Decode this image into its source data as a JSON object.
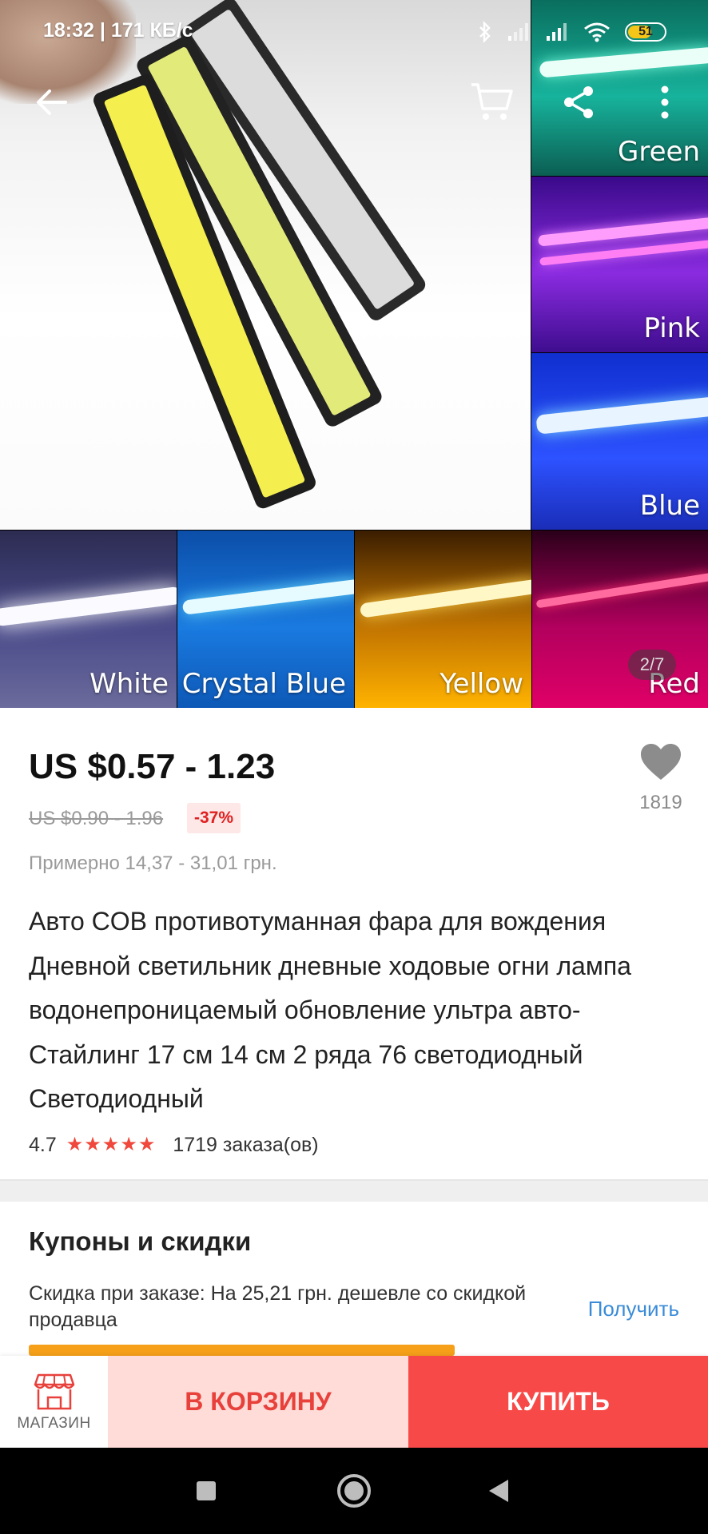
{
  "status_bar": {
    "time": "18:32 | 171 КБ/с",
    "battery": "51"
  },
  "gallery": {
    "page_indicator": "2/7",
    "tiles": [
      {
        "label": "Green"
      },
      {
        "label": "Pink"
      },
      {
        "label": "Blue"
      },
      {
        "label": "White"
      },
      {
        "label": "Crystal Blue"
      },
      {
        "label": "Yellow"
      },
      {
        "label": "Red"
      }
    ]
  },
  "product": {
    "price": "US $0.57 - 1.23",
    "old_price": "US $0.90 - 1.96",
    "discount": "-37%",
    "approx_price": "Примерно 14,37 - 31,01 грн.",
    "wishlist_count": "1819",
    "title": "Авто COB противотуманная фара для вождения Дневной светильник дневные ходовые огни лампа водонепроницаемый обновление ультра авто-Стайлинг 17 см 14 см 2 ряда 76 светодиодный Светодиодный",
    "rating": "4.7",
    "orders": "1719 заказа(ов)"
  },
  "coupons": {
    "title": "Купоны и скидки",
    "text": "Скидка при заказе: На 25,21 грн. дешевле со скидкой продавца",
    "get_label": "Получить"
  },
  "actions": {
    "shop_label": "МАГАЗИН",
    "cart_label": "В КОРЗИНУ",
    "buy_label": "КУПИТЬ"
  },
  "colors": {
    "accent_red": "#f74a48",
    "cart_bg": "#ffdcd8",
    "link_blue": "#3a8bd8",
    "star_red": "#f0483c"
  }
}
